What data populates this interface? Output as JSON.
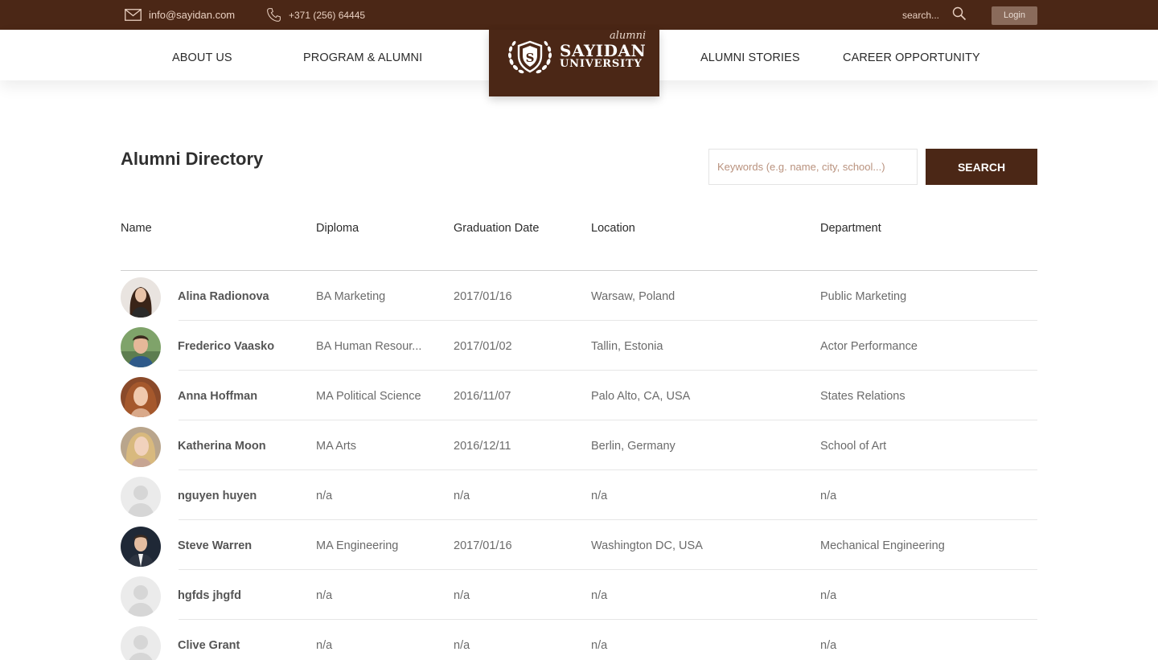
{
  "topbar": {
    "email": "info@sayidan.com",
    "phone": "+371 (256) 64445",
    "search_label": "search...",
    "login_label": "Login",
    "background": "#4b2716"
  },
  "nav": {
    "items": [
      {
        "label": "ABOUT US"
      },
      {
        "label": "PROGRAM & ALUMNI"
      },
      {
        "label": "ALUMNI STORIES"
      },
      {
        "label": "CAREER OPPORTUNITY"
      }
    ]
  },
  "logo": {
    "tagline": "alumni",
    "line1": "SAYIDAN",
    "line2": "UNIVERSITY"
  },
  "page": {
    "title": "Alumni Directory",
    "search_placeholder": "Keywords (e.g. name, city, school...)",
    "search_button": "SEARCH",
    "accent": "#4b2716"
  },
  "table": {
    "headers": {
      "name": "Name",
      "diploma": "Diploma",
      "graduation": "Graduation Date",
      "location": "Location",
      "department": "Department"
    },
    "rows": [
      {
        "name": "Alina Radionova",
        "diploma": "BA Marketing",
        "graduation": "2017/01/16",
        "location": "Warsaw, Poland",
        "department": "Public Marketing",
        "avatar": "photo"
      },
      {
        "name": "Frederico Vaasko",
        "diploma": "BA Human Resour...",
        "graduation": "2017/01/02",
        "location": "Tallin, Estonia",
        "department": "Actor Performance",
        "avatar": "photo"
      },
      {
        "name": "Anna Hoffman",
        "diploma": "MA Political Science",
        "graduation": "2016/11/07",
        "location": "Palo Alto, CA, USA",
        "department": "States Relations",
        "avatar": "photo"
      },
      {
        "name": "Katherina Moon",
        "diploma": "MA Arts",
        "graduation": "2016/12/11",
        "location": "Berlin, Germany",
        "department": "School of Art",
        "avatar": "photo"
      },
      {
        "name": "nguyen huyen",
        "diploma": "n/a",
        "graduation": "n/a",
        "location": "n/a",
        "department": "n/a",
        "avatar": "placeholder"
      },
      {
        "name": "Steve Warren",
        "diploma": "MA Engineering",
        "graduation": "2017/01/16",
        "location": "Washington DC, USA",
        "department": "Mechanical Engineering",
        "avatar": "photo"
      },
      {
        "name": "hgfds jhgfd",
        "diploma": "n/a",
        "graduation": "n/a",
        "location": "n/a",
        "department": "n/a",
        "avatar": "placeholder"
      },
      {
        "name": "Clive Grant",
        "diploma": "n/a",
        "graduation": "n/a",
        "location": "n/a",
        "department": "n/a",
        "avatar": "placeholder"
      }
    ]
  }
}
